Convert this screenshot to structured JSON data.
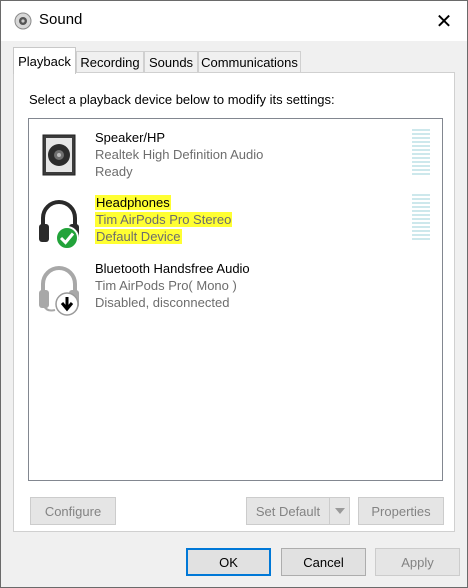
{
  "window": {
    "title": "Sound",
    "close_glyph": "✕",
    "icon": "speaker-icon"
  },
  "tabs": [
    {
      "label": "Playback",
      "active": true
    },
    {
      "label": "Recording",
      "active": false
    },
    {
      "label": "Sounds",
      "active": false
    },
    {
      "label": "Communications",
      "active": false
    }
  ],
  "playback": {
    "instruction": "Select a playback device below to modify its settings:",
    "devices": [
      {
        "name": "Speaker/HP",
        "line2": "Realtek High Definition Audio",
        "line3": "Ready",
        "icon": "speaker-device-icon",
        "highlighted": false,
        "has_meter": true
      },
      {
        "name": "Headphones",
        "line2": "Tim AirPods Pro Stereo",
        "line3": "Default Device",
        "icon": "headphones-icon",
        "badge": "default-check-icon",
        "highlighted": true,
        "has_meter": true
      },
      {
        "name": "Bluetooth Handsfree Audio",
        "line2": "Tim AirPods Pro( Mono )",
        "line3": "Disabled, disconnected",
        "icon": "headset-icon",
        "badge": "disconnected-arrow-icon",
        "highlighted": false,
        "has_meter": false
      }
    ],
    "buttons": {
      "configure": "Configure",
      "set_default": "Set Default",
      "properties": "Properties"
    }
  },
  "footer": {
    "ok": "OK",
    "cancel": "Cancel",
    "apply": "Apply"
  },
  "colors": {
    "highlight": "#ffff32",
    "meter": "#cde8ec",
    "accent": "#0078d7",
    "check_green": "#22a33a"
  }
}
